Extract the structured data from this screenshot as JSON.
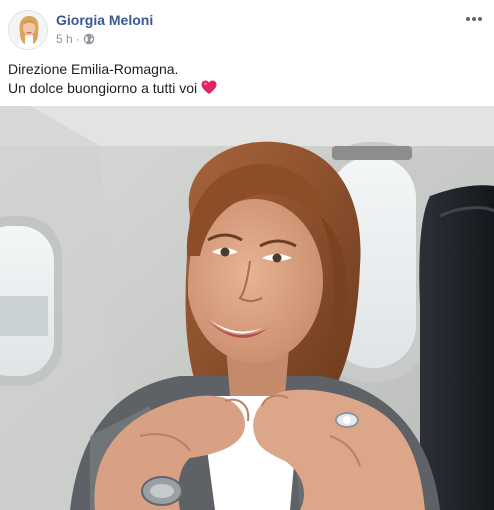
{
  "post": {
    "author": "Giorgia Meloni",
    "time": "5 h",
    "separator": "·",
    "audience_icon": "globe-icon",
    "more_icon": "more-options-icon",
    "text_line1": "Direzione Emilia-Romagna.",
    "text_line2": "Un dolce buongiorno a tutti voi",
    "text_emoji_icon": "red-heart-icon",
    "photo_icon": "photo-woman-heart-hands-airplane"
  },
  "colors": {
    "author_link": "#385898",
    "meta_gray": "#90949c",
    "heart_red": "#e0245e"
  }
}
